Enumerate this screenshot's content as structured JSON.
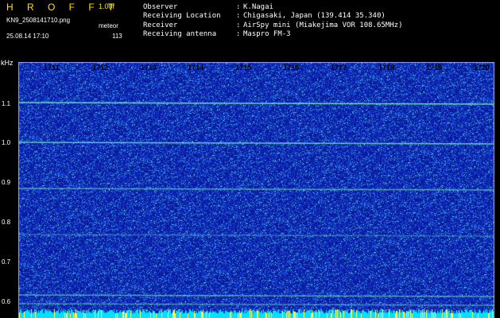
{
  "header": {
    "logo": "H R O F F T",
    "version": "1.00f",
    "filename": "KN9_2508141710.png",
    "mode": "meteor",
    "datetime": "25.08.14 17:10",
    "count": "113"
  },
  "info": [
    {
      "label": "Observer",
      "value": "K.Nagai"
    },
    {
      "label": "Receiving Location",
      "value": "Chigasaki, Japan (139.414 35.340)"
    },
    {
      "label": "Receiver",
      "value": "AirSpy mini (Miakejima VOR 108.65MHz)"
    },
    {
      "label": "Receiving antenna",
      "value": "Maspro FM-3"
    }
  ],
  "axis": {
    "y_unit": "kHz",
    "y_ticks": [
      "1.1",
      "1.0",
      "0.9",
      "0.8",
      "0.7",
      "0.6"
    ],
    "x_ticks": [
      "1711",
      "1712",
      "1713",
      "1714",
      "1715",
      "1716",
      "1717",
      "1718",
      "1719",
      "1720"
    ]
  },
  "colors": {
    "background": "#000000",
    "waterfall_bg": "#0a1a8a",
    "signal": "#40e0c0",
    "header_accent": "#ffe000",
    "bottom_bar": "#00e0ff"
  }
}
